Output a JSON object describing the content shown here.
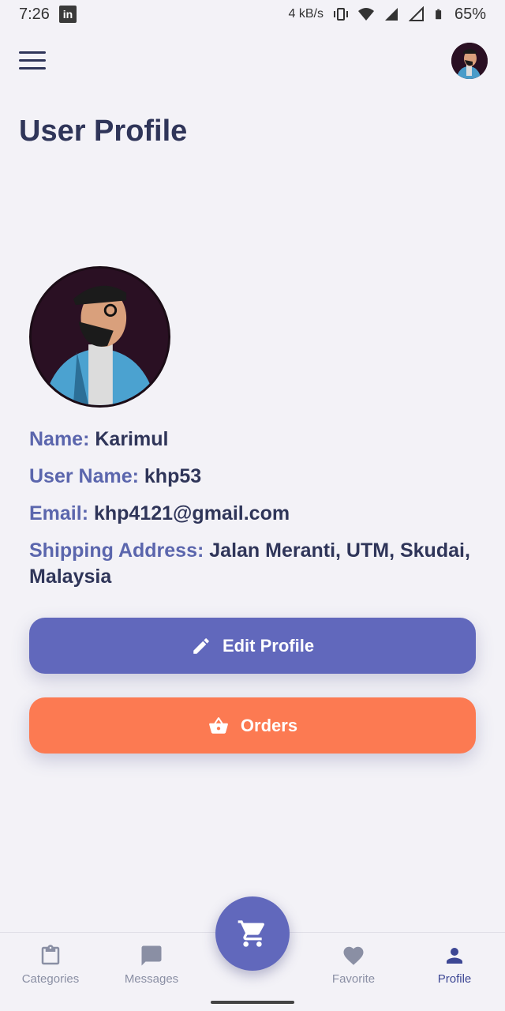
{
  "status_bar": {
    "time": "7:26",
    "linkedin_badge": "in",
    "speed": "4 kB/s",
    "battery": "65%"
  },
  "header": {
    "title": "User Profile"
  },
  "profile": {
    "name_label": "Name:",
    "name_value": "Karimul",
    "username_label": "User Name:",
    "username_value": "khp53",
    "email_label": "Email:",
    "email_value": "khp4121@gmail.com",
    "address_label": "Shipping Address:",
    "address_value": "Jalan Meranti, UTM, Skudai, Malaysia"
  },
  "buttons": {
    "edit_label": "Edit Profile",
    "orders_label": "Orders"
  },
  "bottom_nav": {
    "items": [
      {
        "label": "Categories",
        "icon": "clipboard-icon"
      },
      {
        "label": "Messages",
        "icon": "message-icon"
      },
      {
        "label": "Favorite",
        "icon": "heart-icon"
      },
      {
        "label": "Profile",
        "icon": "person-icon"
      }
    ],
    "active": "Profile",
    "fab_icon": "cart-icon"
  },
  "colors": {
    "background": "#f3f2f7",
    "primary": "#6168bc",
    "orange": "#fc7a52",
    "text_dark": "#2f3559",
    "label_accent": "#5b66ad"
  }
}
